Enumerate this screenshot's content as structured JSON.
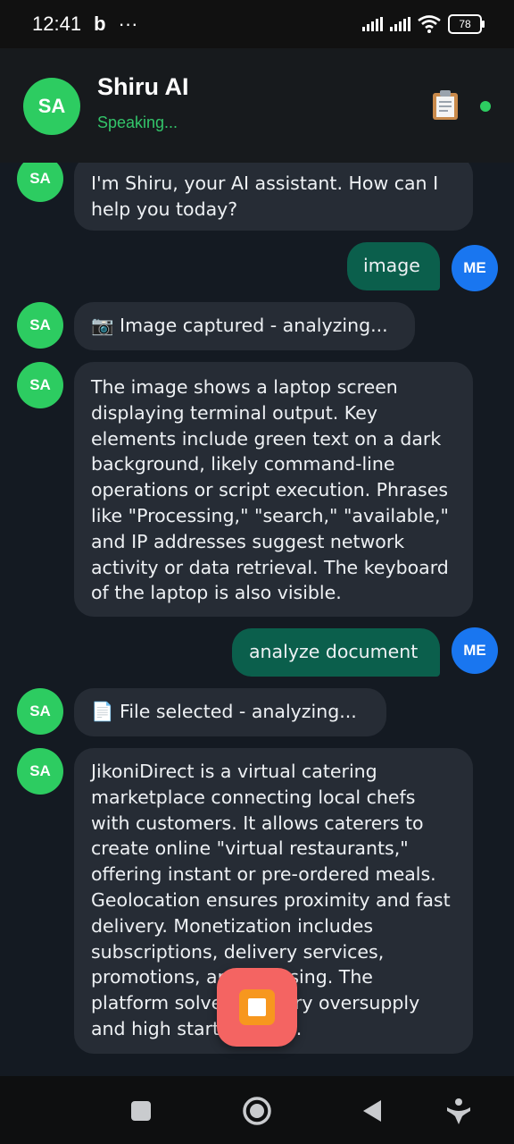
{
  "status_bar": {
    "time": "12:41",
    "notification_icon": "b",
    "more": "···",
    "battery": "78"
  },
  "header": {
    "avatar_initials": "SA",
    "title": "Shiru AI",
    "status": "Speaking...",
    "clipboard_icon": "📋"
  },
  "messages": [
    {
      "sender": "ai",
      "avatar": "SA",
      "text": "I'm Shiru, your AI assistant. How can I help you today?"
    },
    {
      "sender": "user",
      "avatar": "ME",
      "text": "image"
    },
    {
      "sender": "ai",
      "avatar": "SA",
      "text": "📷 Image captured - analyzing..."
    },
    {
      "sender": "ai",
      "avatar": "SA",
      "text": "The image shows a laptop screen displaying terminal output. Key elements include green text on a dark background, likely command-line operations or script execution. Phrases like \"Processing,\" \"search,\" \"available,\" and IP addresses suggest network activity or data retrieval. The keyboard of the laptop is also visible."
    },
    {
      "sender": "user",
      "avatar": "ME",
      "text": "analyze document"
    },
    {
      "sender": "ai",
      "avatar": "SA",
      "text": "📄 File selected - analyzing..."
    },
    {
      "sender": "ai",
      "avatar": "SA",
      "text": "JikoniDirect is a virtual catering marketplace connecting local chefs with customers. It allows caterers to create online \"virtual restaurants,\" offering instant or pre-ordered meals. Geolocation ensures proximity and fast delivery. Monetization includes subscriptions, delivery services, promotions, and licensing. The platform solves industry oversupply and high startup costs."
    }
  ],
  "colors": {
    "ai_avatar": "#2dcc61",
    "user_avatar": "#1976f0",
    "user_bubble": "#0b5f4c",
    "ai_bubble": "#262c35",
    "stop_button": "#f46462"
  },
  "icons": {
    "fab": "stop-icon",
    "nav": [
      "square-icon",
      "circle-home-icon",
      "back-triangle-icon",
      "accessibility-icon"
    ]
  }
}
